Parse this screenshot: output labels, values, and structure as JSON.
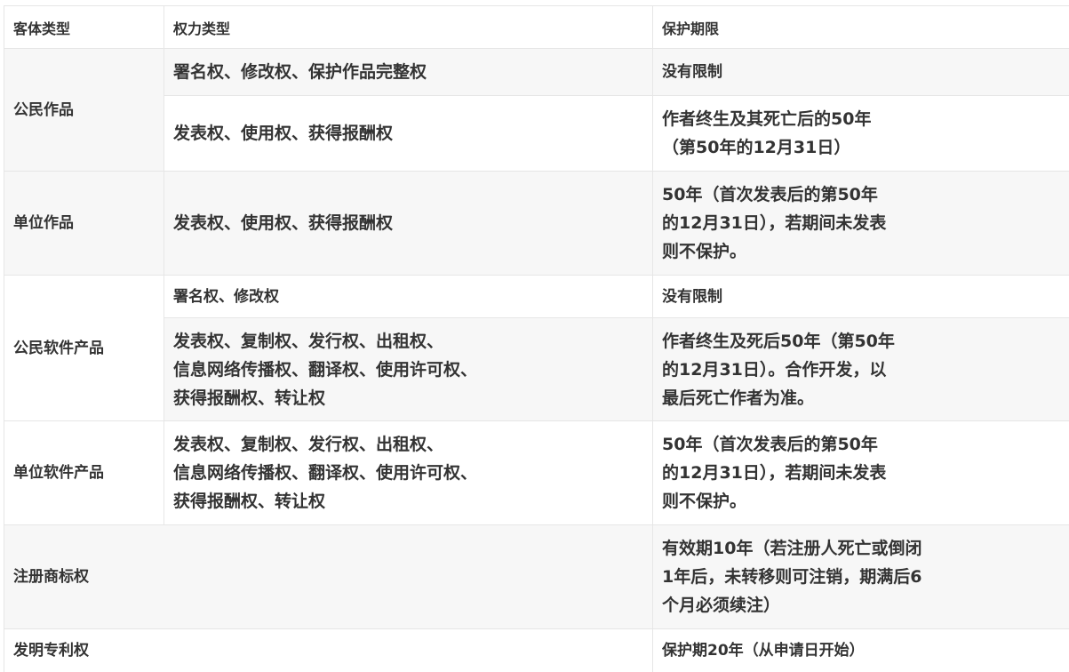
{
  "header": {
    "col1": "客体类型",
    "col2": "权力类型",
    "col3": "保护期限"
  },
  "rows": {
    "citizen_work": {
      "type": "公民作品",
      "rights_a": "署名权、修改权、保护作品完整权",
      "term_a": "没有限制",
      "rights_b": "发表权、使用权、获得报酬权",
      "term_b": "作者终生及其死亡后的50年\n（第50年的12月31日）"
    },
    "unit_work": {
      "type": "单位作品",
      "rights": "发表权、使用权、获得报酬权",
      "term": "50年（首次发表后的第50年\n的12月31日），若期间未发表\n则不保护。"
    },
    "citizen_software": {
      "type": "公民软件产品",
      "rights_a": "署名权、修改权",
      "term_a": "没有限制",
      "rights_b": "发表权、复制权、发行权、出租权、\n信息网络传播权、翻译权、使用许可权、\n获得报酬权、转让权",
      "term_b": "作者终生及死后50年（第50年\n的12月31日）。合作开发，以\n最后死亡作者为准。"
    },
    "unit_software": {
      "type": "单位软件产品",
      "rights": "发表权、复制权、发行权、出租权、\n信息网络传播权、翻译权、使用许可权、\n获得报酬权、转让权",
      "term": "50年（首次发表后的第50年\n的12月31日），若期间未发表\n则不保护。"
    },
    "trademark": {
      "type": "注册商标权",
      "rights": "",
      "term": "有效期10年（若注册人死亡或倒闭\n1年后，未转移则可注销，期满后6\n个月必须续注）"
    },
    "patent": {
      "type": "发明专利权",
      "rights": "",
      "term": "保护期20年（从申请日开始）"
    }
  }
}
